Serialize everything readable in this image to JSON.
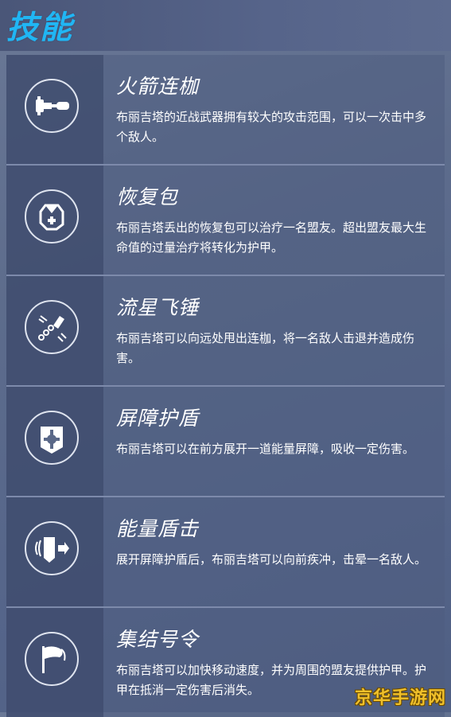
{
  "header": {
    "title": "技能"
  },
  "skills": [
    {
      "name": "火箭连枷",
      "description": "布丽吉塔的近战武器拥有较大的攻击范围，可以一次击中多个敌人。",
      "icon": "rocket-flail-icon"
    },
    {
      "name": "恢复包",
      "description": "布丽吉塔丢出的恢复包可以治疗一名盟友。超出盟友最大生命值的过量治疗将转化为护甲。",
      "icon": "repair-pack-icon"
    },
    {
      "name": "流星飞锤",
      "description": "布丽吉塔可以向远处甩出连枷，将一名敌人击退并造成伤害。",
      "icon": "whip-shot-icon"
    },
    {
      "name": "屏障护盾",
      "description": "布丽吉塔可以在前方展开一道能量屏障，吸收一定伤害。",
      "icon": "barrier-shield-icon"
    },
    {
      "name": "能量盾击",
      "description": "展开屏障护盾后，布丽吉塔可以向前疾冲，击晕一名敌人。",
      "icon": "shield-bash-icon"
    },
    {
      "name": "集结号令",
      "description": "布丽吉塔可以加快移动速度，并为周围的盟友提供护甲。护甲在抵消一定伤害后消失。",
      "icon": "rally-icon"
    }
  ],
  "watermark": "京华手游网",
  "colors": {
    "title": "#20b6f4",
    "watermark": "#f0c02a"
  }
}
